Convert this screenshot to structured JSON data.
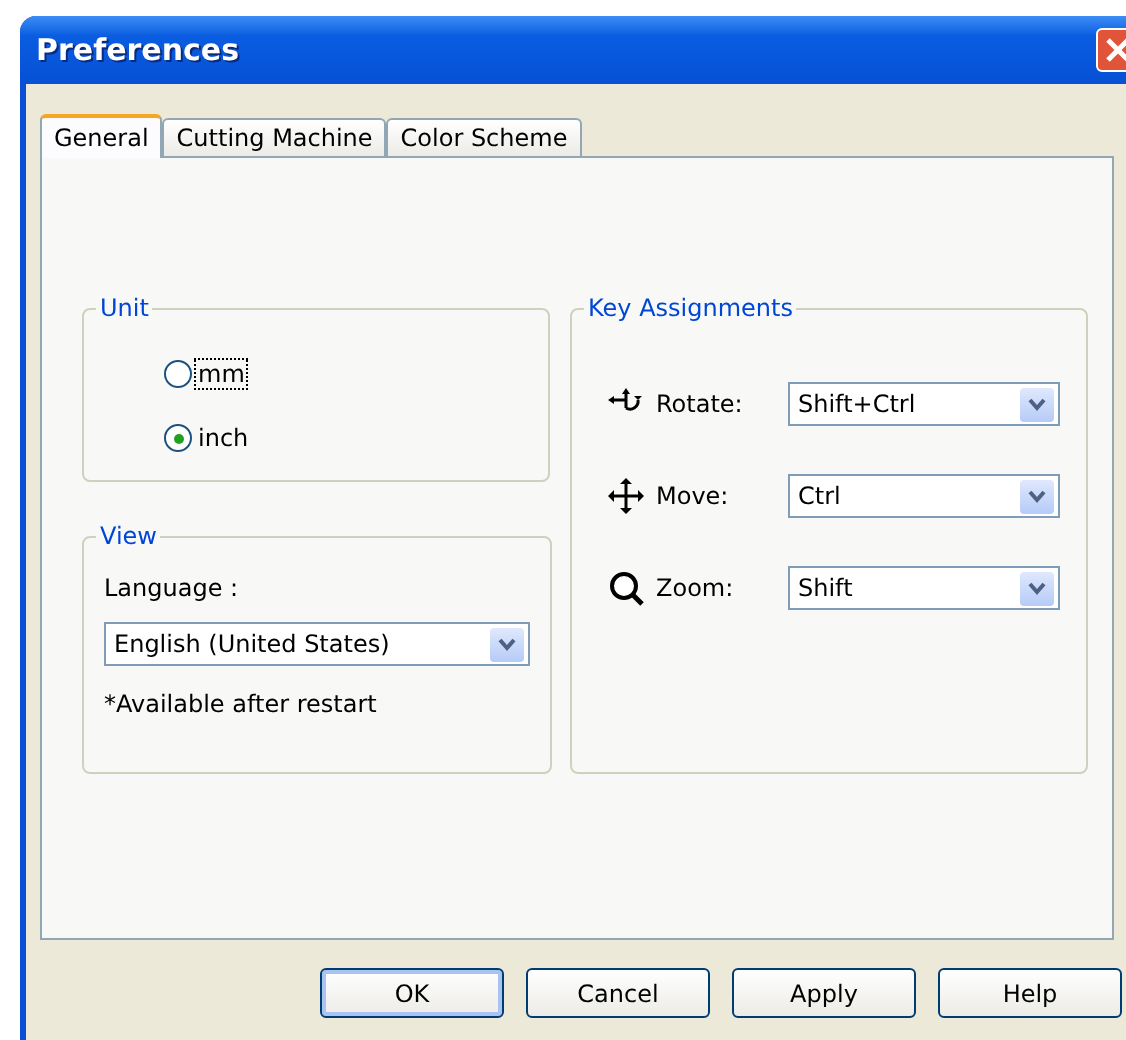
{
  "window": {
    "title": "Preferences"
  },
  "tabs": [
    {
      "label": "General",
      "selected": true
    },
    {
      "label": "Cutting Machine",
      "selected": false
    },
    {
      "label": "Color Scheme",
      "selected": false
    }
  ],
  "unit": {
    "title": "Unit",
    "options": [
      {
        "label": "mm",
        "selected": false,
        "focused": true
      },
      {
        "label": "inch",
        "selected": true,
        "focused": false
      }
    ]
  },
  "view": {
    "title": "View",
    "language_label": "Language :",
    "language_value": "English (United States)",
    "note": "*Available after restart"
  },
  "key_assignments": {
    "title": "Key Assignments",
    "rows": [
      {
        "kind": "rotate",
        "label": "Rotate:",
        "value": "Shift+Ctrl"
      },
      {
        "kind": "move",
        "label": "Move:",
        "value": "Ctrl"
      },
      {
        "kind": "zoom",
        "label": "Zoom:",
        "value": "Shift"
      }
    ]
  },
  "buttons": [
    {
      "label": "OK",
      "default": true
    },
    {
      "label": "Cancel",
      "default": false
    },
    {
      "label": "Apply",
      "default": false
    },
    {
      "label": "Help",
      "default": false
    }
  ]
}
